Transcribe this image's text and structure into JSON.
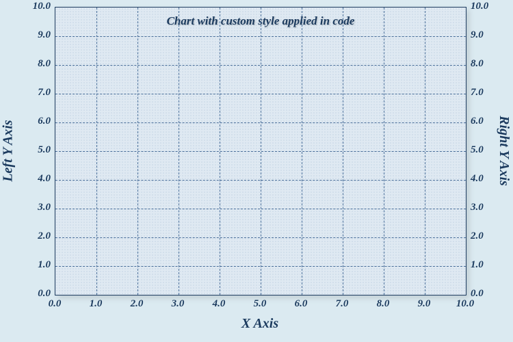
{
  "chart_data": {
    "type": "line",
    "title": "Chart with custom style applied in code",
    "xlabel": "X Axis",
    "ylabel_left": "Left Y Axis",
    "ylabel_right": "Right Y Axis",
    "xlim": [
      0,
      10
    ],
    "ylim": [
      0,
      10
    ],
    "x_ticks": [
      "0.0",
      "1.0",
      "2.0",
      "3.0",
      "4.0",
      "5.0",
      "6.0",
      "7.0",
      "8.0",
      "9.0",
      "10.0"
    ],
    "y_ticks_left": [
      "0.0",
      "1.0",
      "2.0",
      "3.0",
      "4.0",
      "5.0",
      "6.0",
      "7.0",
      "8.0",
      "9.0",
      "10.0"
    ],
    "y_ticks_right": [
      "0.0",
      "1.0",
      "2.0",
      "3.0",
      "4.0",
      "5.0",
      "6.0",
      "7.0",
      "8.0",
      "9.0",
      "10.0"
    ],
    "series": [],
    "grid": true,
    "grid_style": "dashed",
    "colors": {
      "background": "#dbeaf1",
      "plot_fill": "#dfe9f2",
      "axis": "#1b3a5e",
      "grid": "#4a6f9a"
    }
  }
}
